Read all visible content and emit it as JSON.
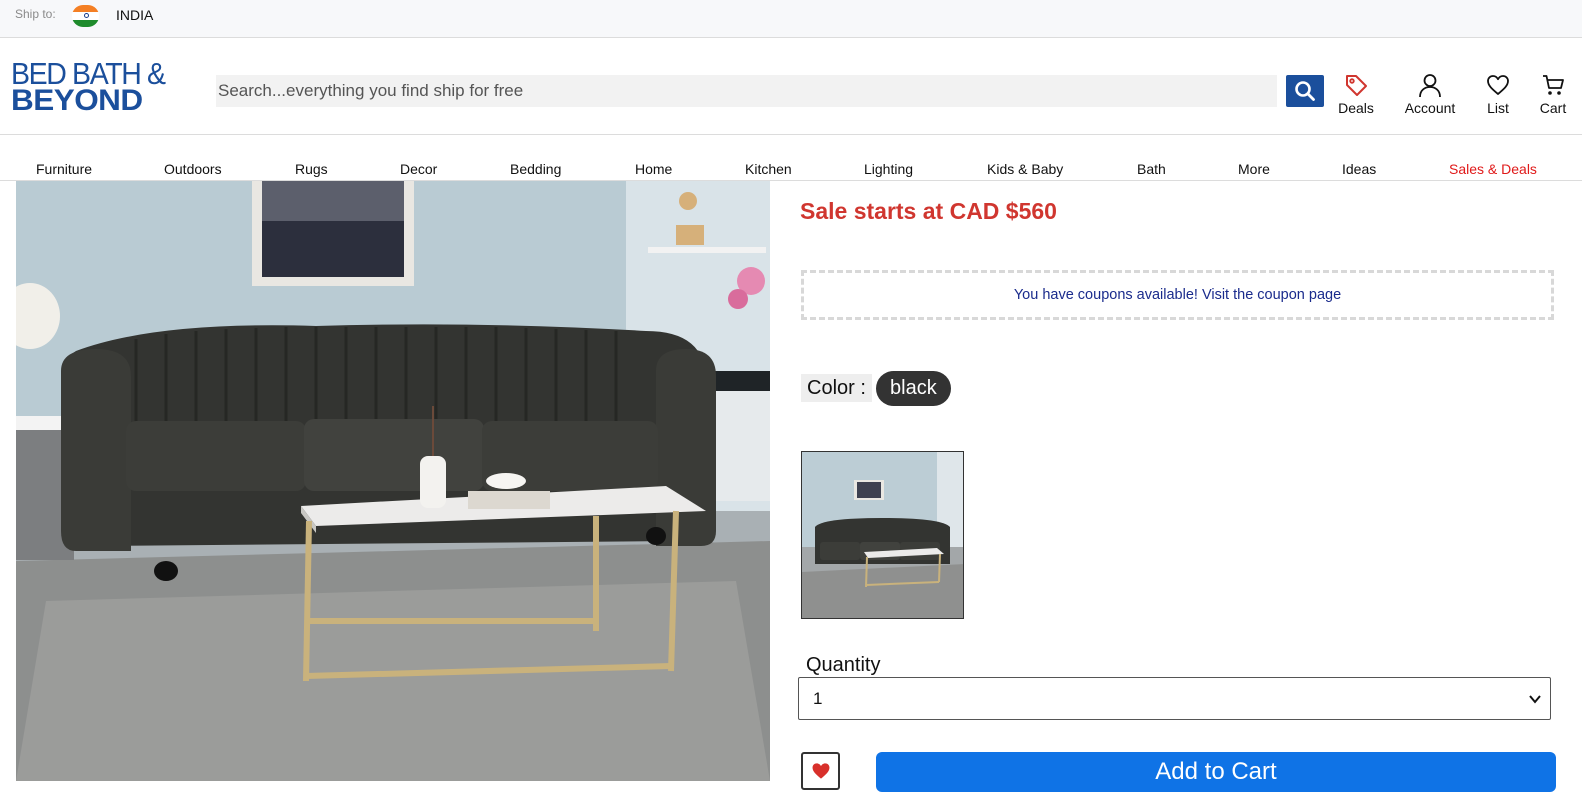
{
  "shipbar": {
    "label": "Ship to:",
    "country": "INDIA",
    "flag_icon": "india-flag-icon"
  },
  "header": {
    "logo_line1": "BED BATH &",
    "logo_line2": "BEYOND",
    "search_placeholder": "Search...everything you find ship for free",
    "search_icon": "search-icon",
    "icons": {
      "deals": "Deals",
      "account": "Account",
      "list": "List",
      "cart": "Cart"
    }
  },
  "nav": {
    "items": [
      "Furniture",
      "Outdoors",
      "Rugs",
      "Decor",
      "Bedding",
      "Home",
      "Kitchen",
      "Lighting",
      "Kids & Baby",
      "Bath",
      "More",
      "Ideas",
      "Sales & Deals"
    ]
  },
  "product": {
    "sale_text": "Sale starts at CAD $560",
    "coupon_text": "You have coupons available! Visit the coupon page",
    "color_label": "Color :",
    "color_value": "black",
    "quantity_label": "Quantity",
    "quantity_value": "1",
    "add_to_cart": "Add to Cart"
  },
  "colors": {
    "brand_blue": "#1b4f9c",
    "sale_red": "#d0362f",
    "nav_sale_red": "#e01919",
    "cart_button_blue": "#0f73e6",
    "coupon_text_blue": "#1a2b8c"
  }
}
